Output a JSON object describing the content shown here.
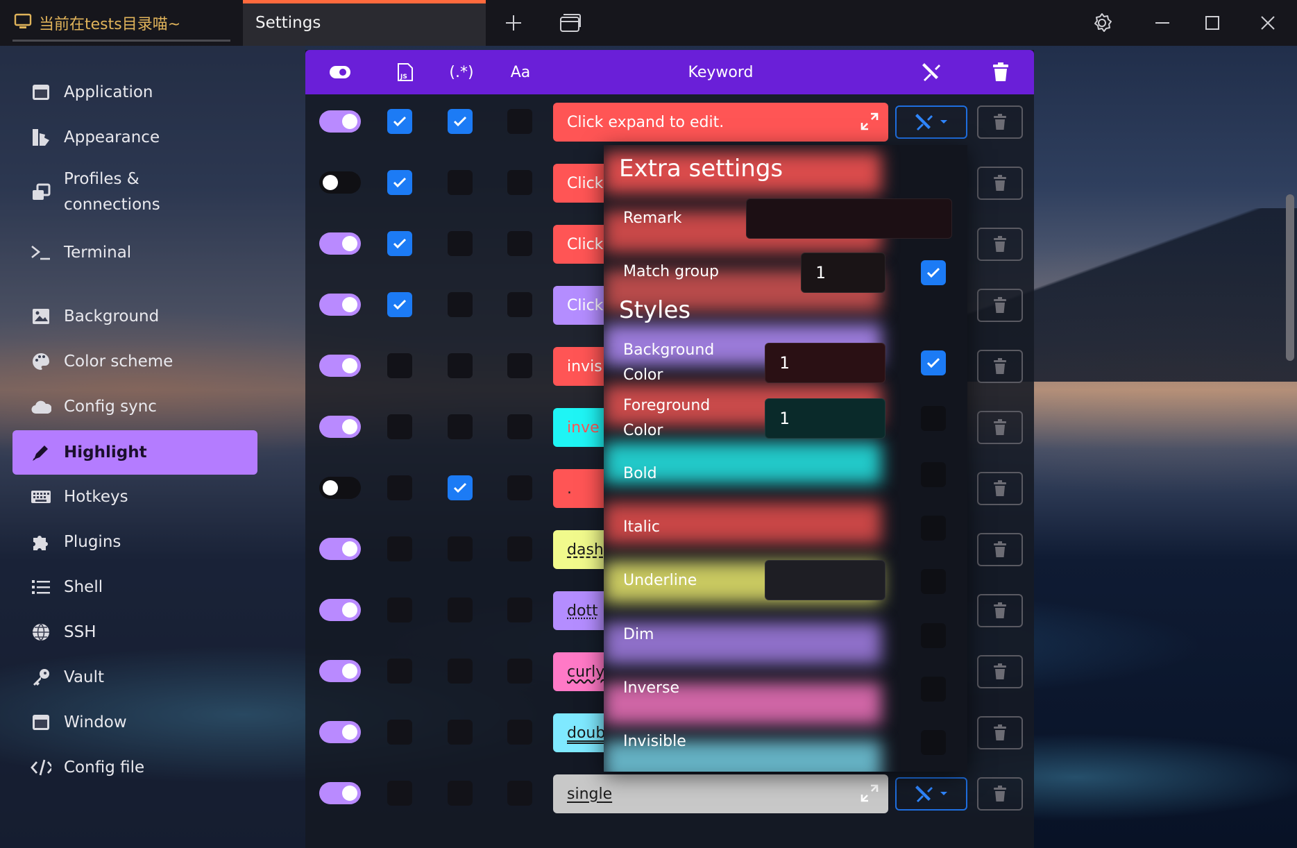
{
  "tabs": {
    "terminal_tab": "当前在tests目录喵~",
    "settings_tab": "Settings"
  },
  "sidebar": {
    "items": [
      {
        "label": "Application",
        "icon": "window-icon"
      },
      {
        "label": "Appearance",
        "icon": "paint-icon"
      },
      {
        "label": "Profiles &\nconnections",
        "icon": "windows-stack-icon"
      },
      {
        "label": "Terminal",
        "icon": "terminal-icon"
      },
      {
        "label": "Background",
        "icon": "image-icon"
      },
      {
        "label": "Color scheme",
        "icon": "palette-icon"
      },
      {
        "label": "Config sync",
        "icon": "cloud-icon"
      },
      {
        "label": "Highlight",
        "icon": "pen-icon",
        "active": true
      },
      {
        "label": "Hotkeys",
        "icon": "keyboard-icon"
      },
      {
        "label": "Plugins",
        "icon": "puzzle-icon"
      },
      {
        "label": "Shell",
        "icon": "list-icon"
      },
      {
        "label": "SSH",
        "icon": "globe-icon"
      },
      {
        "label": "Vault",
        "icon": "key-icon"
      },
      {
        "label": "Window",
        "icon": "window-icon"
      },
      {
        "label": "Config file",
        "icon": "code-icon"
      }
    ]
  },
  "table": {
    "headers": {
      "regex": "(.*)",
      "case": "Aa",
      "keyword": "Keyword"
    },
    "rows": [
      {
        "enabled": true,
        "js": true,
        "regex": true,
        "case": false,
        "text": "Click expand to edit.",
        "bg": "#ff5555",
        "color": "#ffffff",
        "deco": "none"
      },
      {
        "enabled": false,
        "js": true,
        "regex": false,
        "case": false,
        "text": "Click",
        "bg": "#ff5555",
        "color": "#ffffff",
        "deco": "none"
      },
      {
        "enabled": true,
        "js": true,
        "regex": false,
        "case": false,
        "text": "Click",
        "bg": "#ff5555",
        "color": "#ffffff",
        "deco": "none"
      },
      {
        "enabled": true,
        "js": true,
        "regex": false,
        "case": false,
        "text": "Click",
        "bg": "#b48dff",
        "color": "#ffffff",
        "deco": "none"
      },
      {
        "enabled": true,
        "js": false,
        "regex": false,
        "case": false,
        "text": "invis",
        "bg": "#ff5555",
        "color": "#ffffff",
        "deco": "none"
      },
      {
        "enabled": true,
        "js": false,
        "regex": false,
        "case": false,
        "text": "inve",
        "bg": "#1ff5f5",
        "color": "#ff5555",
        "deco": "none"
      },
      {
        "enabled": false,
        "js": false,
        "regex": true,
        "case": false,
        "text": ".",
        "bg": "#ff5555",
        "color": "#222222",
        "deco": "none"
      },
      {
        "enabled": true,
        "js": false,
        "regex": false,
        "case": false,
        "text": "dash",
        "bg": "#f1fa8c",
        "color": "#1b1b1b",
        "deco": "underline dashed"
      },
      {
        "enabled": true,
        "js": false,
        "regex": false,
        "case": false,
        "text": "dott",
        "bg": "#b48dff",
        "color": "#1b1b1b",
        "deco": "underline dotted"
      },
      {
        "enabled": true,
        "js": false,
        "regex": false,
        "case": false,
        "text": "curly",
        "bg": "#ff79c6",
        "color": "#1b1b1b",
        "deco": "underline wavy"
      },
      {
        "enabled": true,
        "js": false,
        "regex": false,
        "case": false,
        "text": "doub",
        "bg": "#7fe9ff",
        "color": "#1b1b1b",
        "deco": "underline double"
      },
      {
        "enabled": true,
        "js": false,
        "regex": false,
        "case": false,
        "text": "single",
        "bg": "#c8c8c8",
        "color": "#1b1b1b",
        "deco": "underline solid"
      }
    ]
  },
  "popover": {
    "title": "Extra settings",
    "remark_label": "Remark",
    "remark_value": "",
    "match_group_label": "Match group",
    "match_group_value": "1",
    "match_group_checked": true,
    "styles_title": "Styles",
    "bg_color_label": "Background\nColor",
    "bg_color_value": "1",
    "bg_color_checked": true,
    "fg_color_label": "Foreground\nColor",
    "fg_color_value": "1",
    "fg_color_checked": false,
    "bold_label": "Bold",
    "italic_label": "Italic",
    "underline_label": "Underline",
    "underline_value": "",
    "dim_label": "Dim",
    "inverse_label": "Inverse",
    "invisible_label": "Invisible"
  },
  "colors": {
    "accent": "#6a1fd8",
    "active_nav": "#b47cff",
    "toggle_on": "#b98aff",
    "checkbox_on": "#1c7bf5",
    "tab_indicator": "#ff6a3d"
  }
}
